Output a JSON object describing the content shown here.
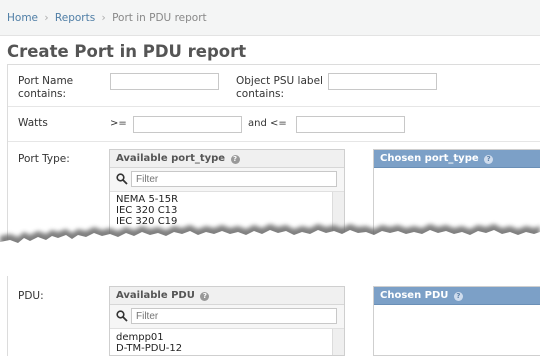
{
  "breadcrumb": {
    "home": "Home",
    "separator": "›",
    "reports": "Reports",
    "current": "Port in PDU report"
  },
  "page_title": "Create Port in PDU report",
  "form": {
    "port_name_label": "Port Name contains:",
    "port_name_value": "",
    "object_psu_label": "Object PSU label contains:",
    "object_psu_value": "",
    "watts_label": "Watts",
    "watts_gte_op": ">=",
    "watts_gte_value": "",
    "watts_and_lte_op": "and <=",
    "watts_lte_value": "",
    "port_type_label": "Port Type:",
    "pdu_label": "PDU:"
  },
  "port_type_selector": {
    "available_title": "Available port_type",
    "chosen_title": "Chosen port_type",
    "help_glyph": "?",
    "filter_placeholder": "Filter",
    "options": [
      "NEMA 5-15R",
      "IEC 320 C13",
      "IEC 320 C19"
    ]
  },
  "pdu_selector": {
    "available_title": "Available PDU",
    "chosen_title": "Chosen PDU",
    "help_glyph": "?",
    "filter_placeholder": "Filter",
    "options": [
      "dempp01",
      "D-TM-PDU-12"
    ]
  },
  "icons": {
    "search": "magnifier-icon",
    "help": "help-icon"
  },
  "colors": {
    "link": "#4f7ea6",
    "chosen_header": "#7ca0c7",
    "title": "#555555"
  }
}
